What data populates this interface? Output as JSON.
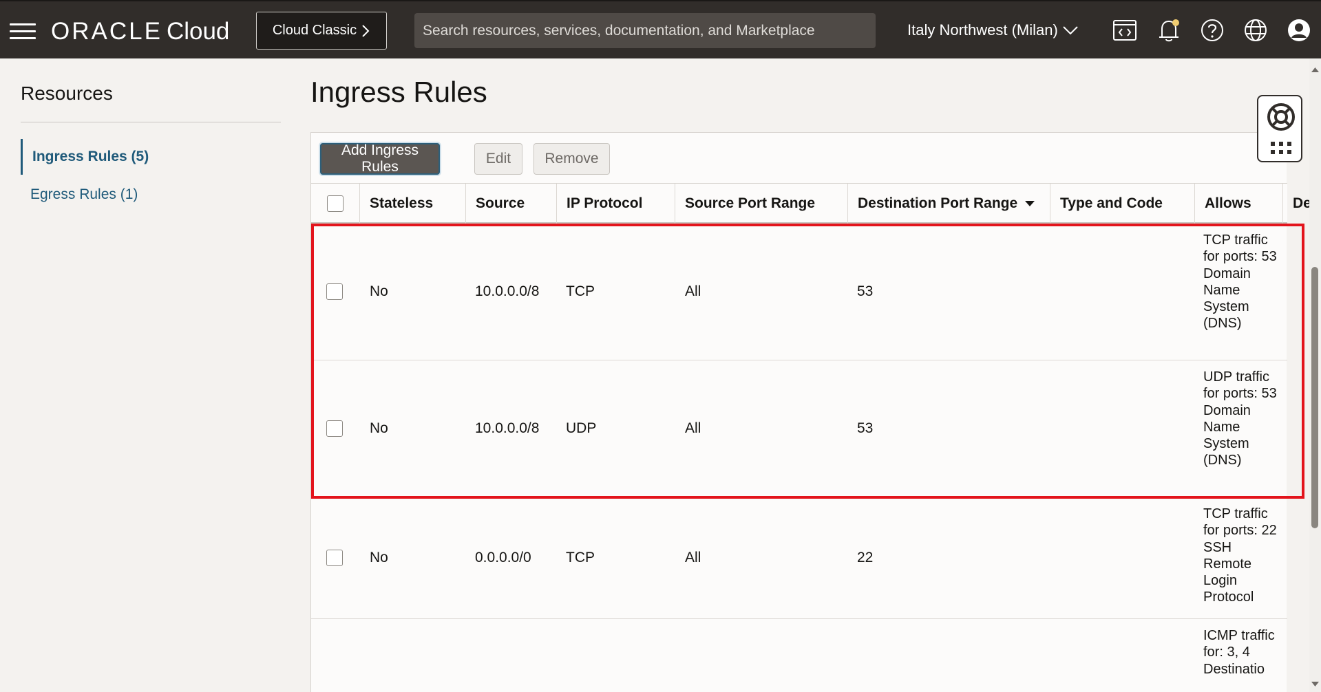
{
  "header": {
    "brand_oracle": "ORACLE",
    "brand_cloud": "Cloud",
    "classic_button": "Cloud Classic",
    "search_placeholder": "Search resources, services, documentation, and Marketplace",
    "region": "Italy Northwest (Milan)",
    "icons": [
      "code-editor-icon",
      "bell-icon",
      "help-icon",
      "globe-icon",
      "user-profile-icon"
    ]
  },
  "sidebar": {
    "title": "Resources",
    "items": [
      {
        "label": "Ingress Rules (5)",
        "active": true
      },
      {
        "label": "Egress Rules (1)",
        "active": false
      }
    ]
  },
  "page": {
    "title": "Ingress Rules"
  },
  "toolbar": {
    "add": "Add Ingress Rules",
    "edit": "Edit",
    "remove": "Remove"
  },
  "table": {
    "columns": [
      "Stateless",
      "Source",
      "IP Protocol",
      "Source Port Range",
      "Destination Port Range",
      "Type and Code",
      "Allows",
      "De"
    ],
    "rows": [
      {
        "stateless": "No",
        "source": "10.0.0.0/8",
        "protocol": "TCP",
        "src_port": "All",
        "dst_port": "53",
        "type_code": "",
        "allows": "TCP traffic for ports: 53 Domain Name System (DNS)"
      },
      {
        "stateless": "No",
        "source": "10.0.0.0/8",
        "protocol": "UDP",
        "src_port": "All",
        "dst_port": "53",
        "type_code": "",
        "allows": "UDP traffic for ports: 53 Domain Name System (DNS)"
      },
      {
        "stateless": "No",
        "source": "0.0.0.0/0",
        "protocol": "TCP",
        "src_port": "All",
        "dst_port": "22",
        "type_code": "",
        "allows": "TCP traffic for ports: 22 SSH Remote Login Protocol"
      },
      {
        "stateless": "",
        "source": "",
        "protocol": "",
        "src_port": "",
        "dst_port": "",
        "type_code": "",
        "allows": "ICMP traffic for: 3, 4 Destinatio"
      }
    ]
  },
  "colors": {
    "header_bg": "#312d2a",
    "link": "#1f5a7a",
    "highlight": "#e3141c"
  }
}
